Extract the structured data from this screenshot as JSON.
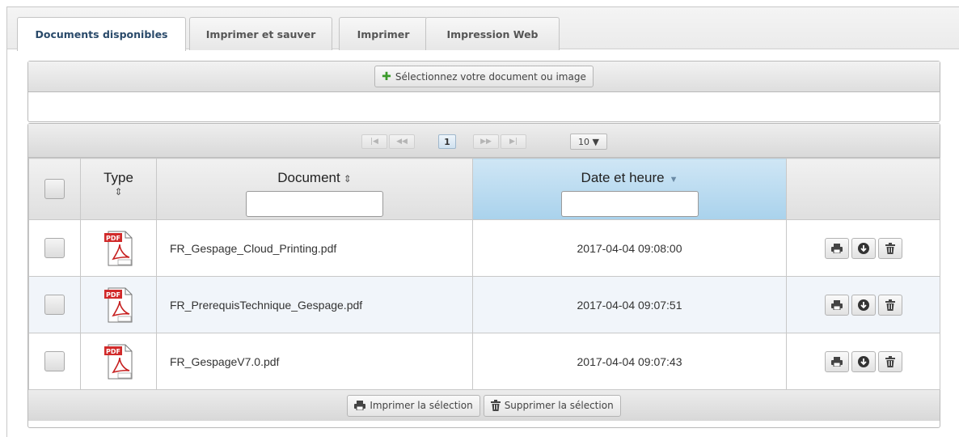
{
  "tabs": [
    {
      "label": "Documents disponibles",
      "active": true
    },
    {
      "label": "Imprimer et sauver",
      "active": false
    },
    {
      "label": "Imprimer",
      "active": false
    },
    {
      "label": "Impression Web",
      "active": false
    }
  ],
  "upload": {
    "button_label": "Sélectionnez votre document ou image"
  },
  "pagination": {
    "current_page": "1",
    "rows_per_page": "10 ▼"
  },
  "table": {
    "columns": {
      "type": "Type",
      "document": "Document",
      "date": "Date et heure"
    },
    "filters": {
      "document": "",
      "date": ""
    },
    "rows": [
      {
        "document": "FR_Gespage_Cloud_Printing.pdf",
        "date": "2017-04-04 09:08:00"
      },
      {
        "document": "FR_PrerequisTechnique_Gespage.pdf",
        "date": "2017-04-04 09:07:51"
      },
      {
        "document": "FR_GespageV7.0.pdf",
        "date": "2017-04-04 09:07:43"
      }
    ]
  },
  "footer": {
    "print_selection": "Imprimer la sélection",
    "delete_selection": "Supprimer la sélection"
  },
  "icons": {
    "file": "pdf-file-icon",
    "print": "printer-icon",
    "download": "download-icon",
    "delete": "trash-icon",
    "add": "plus-icon"
  },
  "colors": {
    "sorted_header": "#a9d2ec",
    "alt_row": "#f1f5fa",
    "pdf_red": "#d12a2a"
  }
}
